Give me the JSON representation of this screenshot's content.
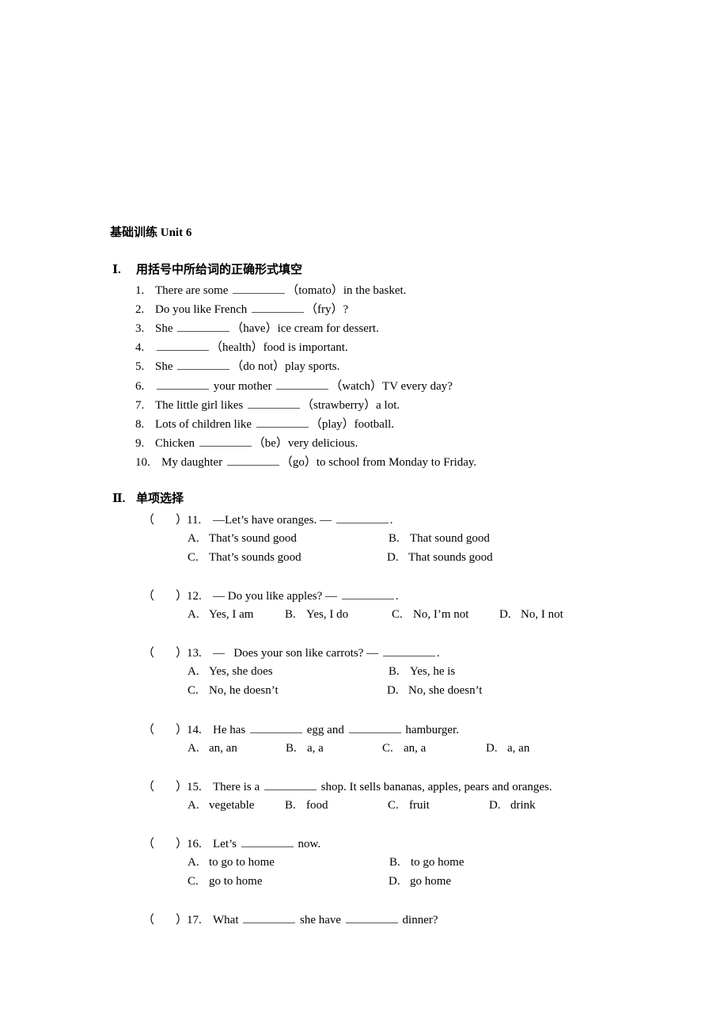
{
  "title": "基础训练 Unit 6",
  "section1": {
    "number": "Ⅰ.",
    "heading": "用括号中所给词的正确形式填空",
    "items": [
      {
        "num": "1.",
        "parts": [
          "There are some",
          "（tomato）in the basket."
        ]
      },
      {
        "num": "2.",
        "parts": [
          "Do you like French",
          "（fry）?"
        ]
      },
      {
        "num": "3.",
        "parts": [
          "She",
          "（have）ice cream for dessert."
        ]
      },
      {
        "num": "4.",
        "parts": [
          "",
          "（health）food is important."
        ]
      },
      {
        "num": "5.",
        "parts": [
          "She",
          "（do not）play sports."
        ]
      },
      {
        "num": "6.",
        "parts": [
          "",
          "your mother",
          "（watch）TV every day?"
        ]
      },
      {
        "num": "7.",
        "parts": [
          "The little girl likes",
          "（strawberry）a lot."
        ]
      },
      {
        "num": "8.",
        "parts": [
          "Lots of children like",
          "（play）football."
        ]
      },
      {
        "num": "9.",
        "parts": [
          "Chicken",
          "（be）very delicious."
        ]
      },
      {
        "num": "10.",
        "parts": [
          "My daughter",
          "（go）to school from Monday to Friday."
        ]
      }
    ]
  },
  "section2": {
    "number": "Ⅱ.",
    "heading": "单项选择",
    "paren_open": "（",
    "paren_close": "）",
    "questions": [
      {
        "num": "11.",
        "parts": [
          "—Let’s have oranges. —",
          "."
        ],
        "options": [
          {
            "letter": "A.",
            "text": "That’s sound good"
          },
          {
            "letter": "B.",
            "text": "That sound good"
          },
          {
            "letter": "C.",
            "text": "That’s sounds good"
          },
          {
            "letter": "D.",
            "text": "That sounds good"
          }
        ]
      },
      {
        "num": "12.",
        "parts": [
          "— Do you like apples? —",
          "."
        ],
        "options": [
          {
            "letter": "A.",
            "text": "Yes, I am"
          },
          {
            "letter": "B.",
            "text": "Yes, I do"
          },
          {
            "letter": "C.",
            "text": "No, I’m not"
          },
          {
            "letter": "D.",
            "text": "No, I not"
          }
        ]
      },
      {
        "num": "13.",
        "parts": [
          "—   Does your son like carrots? —",
          "."
        ],
        "options": [
          {
            "letter": "A.",
            "text": "Yes, she does"
          },
          {
            "letter": "B.",
            "text": "Yes, he is"
          },
          {
            "letter": "C.",
            "text": "No, he doesn’t"
          },
          {
            "letter": "D.",
            "text": "No, she doesn’t"
          }
        ]
      },
      {
        "num": "14.",
        "parts": [
          "He has",
          "egg and",
          "hamburger."
        ],
        "options": [
          {
            "letter": "A.",
            "text": "an, an"
          },
          {
            "letter": "B.",
            "text": "a, a"
          },
          {
            "letter": "C.",
            "text": "an, a"
          },
          {
            "letter": "D.",
            "text": "a, an"
          }
        ]
      },
      {
        "num": "15.",
        "parts": [
          "There is a",
          "shop. It sells bananas, apples, pears and oranges."
        ],
        "options": [
          {
            "letter": "A.",
            "text": "vegetable"
          },
          {
            "letter": "B.",
            "text": "food"
          },
          {
            "letter": "C.",
            "text": "fruit"
          },
          {
            "letter": "D.",
            "text": "drink"
          }
        ]
      },
      {
        "num": "16.",
        "parts": [
          "Let’s",
          "now."
        ],
        "options": [
          {
            "letter": "A.",
            "text": "to go to home"
          },
          {
            "letter": "B.",
            "text": "to go home"
          },
          {
            "letter": "C.",
            "text": "go to home"
          },
          {
            "letter": "D.",
            "text": "go home"
          }
        ]
      },
      {
        "num": "17.",
        "parts": [
          "What",
          "she have",
          "dinner?"
        ],
        "options": []
      }
    ]
  }
}
